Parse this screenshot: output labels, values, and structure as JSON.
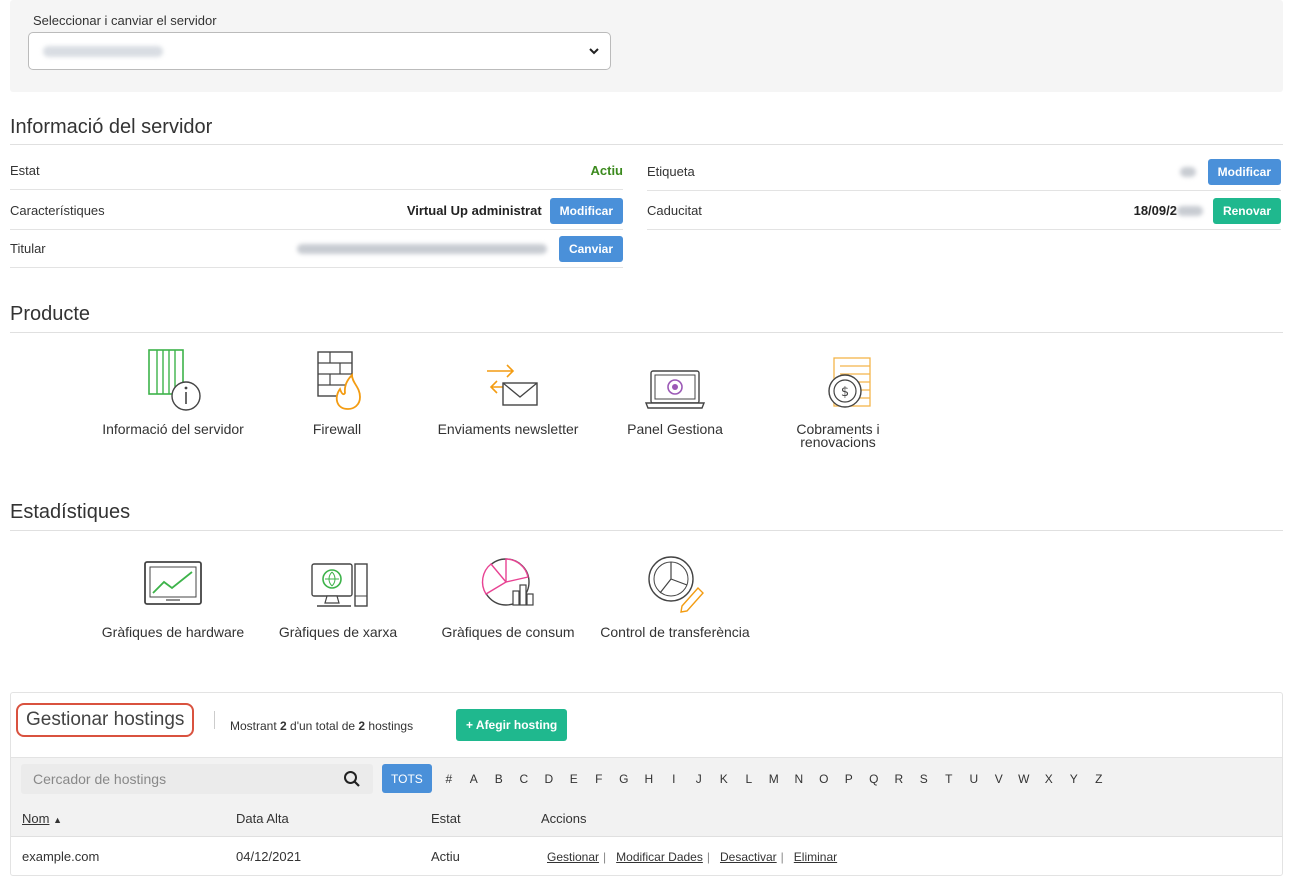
{
  "server_selector": {
    "label": "Seleccionar i canviar el servidor",
    "selected_value": ""
  },
  "server_info": {
    "title": "Informació del servidor",
    "rows_left": [
      {
        "key": "Estat",
        "value": "Actiu",
        "button": ""
      },
      {
        "key": "Característiques",
        "value": "Virtual Up administrat",
        "button": "Modificar"
      },
      {
        "key": "Titular",
        "value": "",
        "button": "Canviar"
      }
    ],
    "rows_right": [
      {
        "key": "Etiqueta",
        "value": "",
        "button": "Modificar"
      },
      {
        "key": "Caducitat",
        "value": "18/09/2",
        "button": "Renovar"
      }
    ]
  },
  "producte": {
    "title": "Producte",
    "items": [
      {
        "label": "Informació del servidor",
        "icon": "server-info-icon"
      },
      {
        "label": "Firewall",
        "icon": "firewall-icon"
      },
      {
        "label": "Enviaments newsletter",
        "icon": "newsletter-icon"
      },
      {
        "label": "Panel Gestiona",
        "icon": "panel-icon"
      },
      {
        "label": "Cobraments i renovacions",
        "icon": "billing-icon"
      }
    ]
  },
  "estadistiques": {
    "title": "Estadístiques",
    "items": [
      {
        "label": "Gràfiques de hardware",
        "icon": "hardware-chart-icon"
      },
      {
        "label": "Gràfiques de xarxa",
        "icon": "network-chart-icon"
      },
      {
        "label": "Gràfiques de consum",
        "icon": "consumption-chart-icon"
      },
      {
        "label": "Control de transferència",
        "icon": "transfer-control-icon"
      }
    ]
  },
  "hostings": {
    "title": "Gestionar hostings",
    "count_prefix": "Mostrant ",
    "count_shown": "2",
    "count_middle": " d'un total de ",
    "count_total": "2",
    "count_suffix": " hostings",
    "add_button": "+ Afegir hosting",
    "search_placeholder": "Cercador de hostings",
    "letters": [
      "TOTS",
      "#",
      "A",
      "B",
      "C",
      "D",
      "E",
      "F",
      "G",
      "H",
      "I",
      "J",
      "K",
      "L",
      "M",
      "N",
      "O",
      "P",
      "Q",
      "R",
      "S",
      "T",
      "U",
      "V",
      "W",
      "X",
      "Y",
      "Z"
    ],
    "columns": {
      "name": "Nom",
      "date": "Data Alta",
      "status": "Estat",
      "actions": "Accions"
    },
    "rows": [
      {
        "name": "example.com",
        "date": "04/12/2021",
        "status": "Actiu",
        "actions": [
          "Gestionar",
          "Modificar Dades",
          "Desactivar",
          "Eliminar"
        ]
      }
    ]
  },
  "colors": {
    "blue": "#4a90d9",
    "green": "#1fb88e",
    "active_green": "#3c8a1e",
    "highlight_red": "#d9523f"
  }
}
